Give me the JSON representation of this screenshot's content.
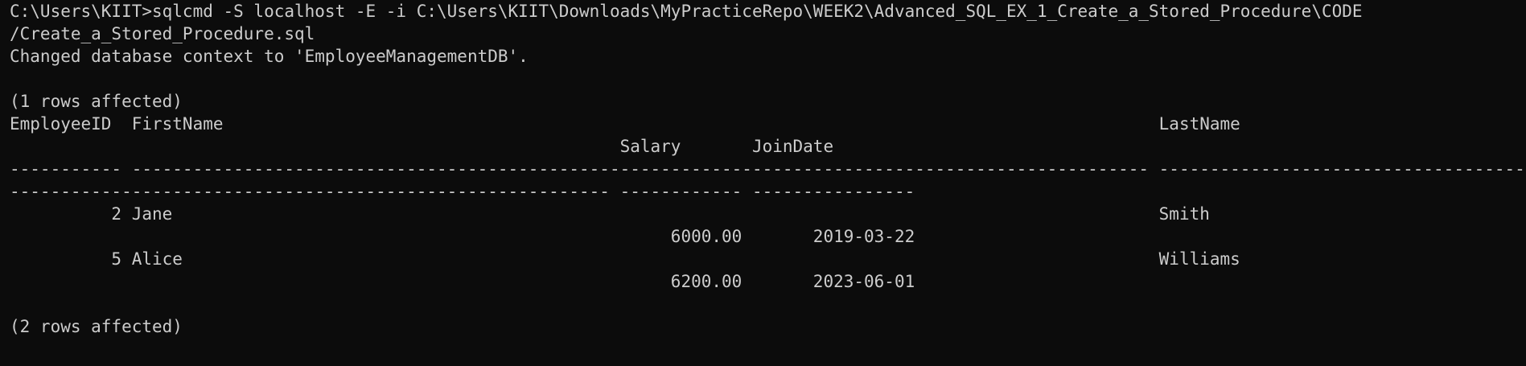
{
  "terminal": {
    "background_color": "#0c0c0c",
    "text_color": "#cccccc",
    "lines": [
      "C:\\Users\\KIIT>sqlcmd -S localhost -E -i C:\\Users\\KIIT\\Downloads\\MyPracticeRepo\\WEEK2\\Advanced_SQL_EX_1_Create_a_Stored_Procedure\\CODE",
      "/Create_a_Stored_Procedure.sql",
      "Changed database context to 'EmployeeManagementDB'.",
      "",
      "(1 rows affected)",
      "EmployeeID  FirstName                                                                                            LastName",
      "                                                            Salary       JoinDate",
      "----------- ---------------------------------------------------------------------------------------------------- ----------------------------------------------------------------------------------------------------",
      "----------------------------------------------------------- ------------ ----------------",
      "          2 Jane                                                                                                 Smith",
      "                                                                 6000.00       2019-03-22",
      "          5 Alice                                                                                                Williams",
      "                                                                 6200.00       2023-06-01",
      "",
      "(2 rows affected)"
    ]
  }
}
